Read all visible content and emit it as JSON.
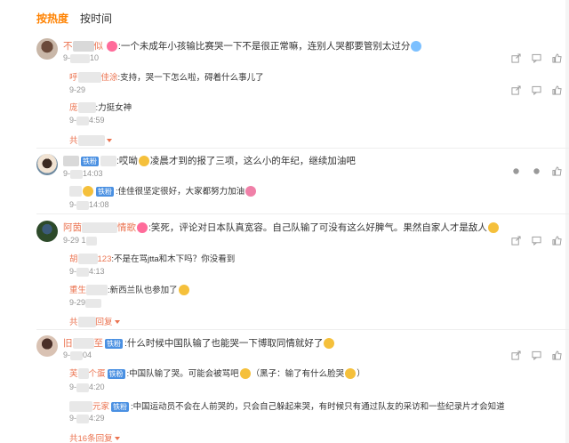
{
  "tabs": {
    "hot": "按热度",
    "time": "按时间"
  },
  "comments": [
    {
      "name_prefix": "不",
      "name_suffix": "似",
      "text": ":一个未成年小孩输比赛哭一下不是很正常嘛，连别人哭都要管别太过分",
      "time_prefix": "9-",
      "time_suffix": "10",
      "replies": [
        {
          "name_prefix": "呼",
          "name_suffix": "佳涂",
          "text": ":支持，哭一下怎么啦，碍着什么事儿了",
          "time_prefix": "9-29",
          "time_suffix": "",
          "show_time": false
        },
        {
          "name_prefix": "庞",
          "name_suffix": "",
          "text": ":力挺女神",
          "time_prefix": "9-",
          "time_suffix": "4:59",
          "show_time": true
        }
      ],
      "more": "共"
    },
    {
      "name_prefix": "",
      "name_suffix": "",
      "badge": "铁粉",
      "text": ":哎呦",
      "text2": "凌晨才到的报了三项，这么小的年纪，继续加油吧",
      "time_prefix": "9-",
      "time_suffix": "14:03",
      "replies": [
        {
          "name_prefix": "",
          "name_suffix": "",
          "badge": "铁粉",
          "text": ":佳佳很坚定很好，大家都努力加油",
          "time_prefix": "9-",
          "time_suffix": "14:08",
          "show_time": true
        }
      ]
    },
    {
      "name_prefix": "阿茵",
      "name_suffix": "情歌",
      "text": ":笑死，评论对日本队真宽容。自己队输了可没有这么好脾气。果然自家人才是敌人",
      "time_prefix": "9-29 1",
      "time_suffix": "",
      "replies": [
        {
          "name_prefix": "胡",
          "name_suffix": "123",
          "text": ":不是在骂jtta和木下吗？你没看到",
          "time_prefix": "9-",
          "time_suffix": "4:13",
          "show_time": true
        },
        {
          "name_prefix": "重生",
          "name_suffix": "",
          "text": ":新西兰队也参加了",
          "time_prefix": "9-29",
          "time_suffix": "",
          "show_time": true
        }
      ],
      "more": "共",
      "more_tail": "回复"
    },
    {
      "name_prefix": "旧",
      "name_suffix": "至",
      "badge": "铁粉",
      "text": ":什么时候中国队输了也能哭一下博取同情就好了",
      "time_prefix": "9-",
      "time_suffix": "04",
      "replies": [
        {
          "name_prefix": "芙",
          "name_suffix": "个蛋",
          "badge": "铁粉",
          "text": ":中国队输了哭。可能会被骂吧",
          "text2": "（黑子：输了有什么脸哭",
          "text3": "）",
          "time_prefix": "9-",
          "time_suffix": "4:20",
          "show_time": true
        },
        {
          "name_prefix": "",
          "name_suffix": "元家",
          "badge": "铁粉",
          "text": ":中国运动员不会在人前哭的，只会自己躲起来哭，有时候只有通过队友的采访和一些纪录片才会知道",
          "time_prefix": "9-",
          "time_suffix": "4:29",
          "show_time": true
        }
      ],
      "more": "共16条回复"
    }
  ],
  "icons": [
    "share-icon",
    "comment-icon",
    "like-icon"
  ],
  "colors": {
    "accent": "#ff8200",
    "username": "#eb7350",
    "time": "#939393",
    "badge": "#4a90e2"
  }
}
